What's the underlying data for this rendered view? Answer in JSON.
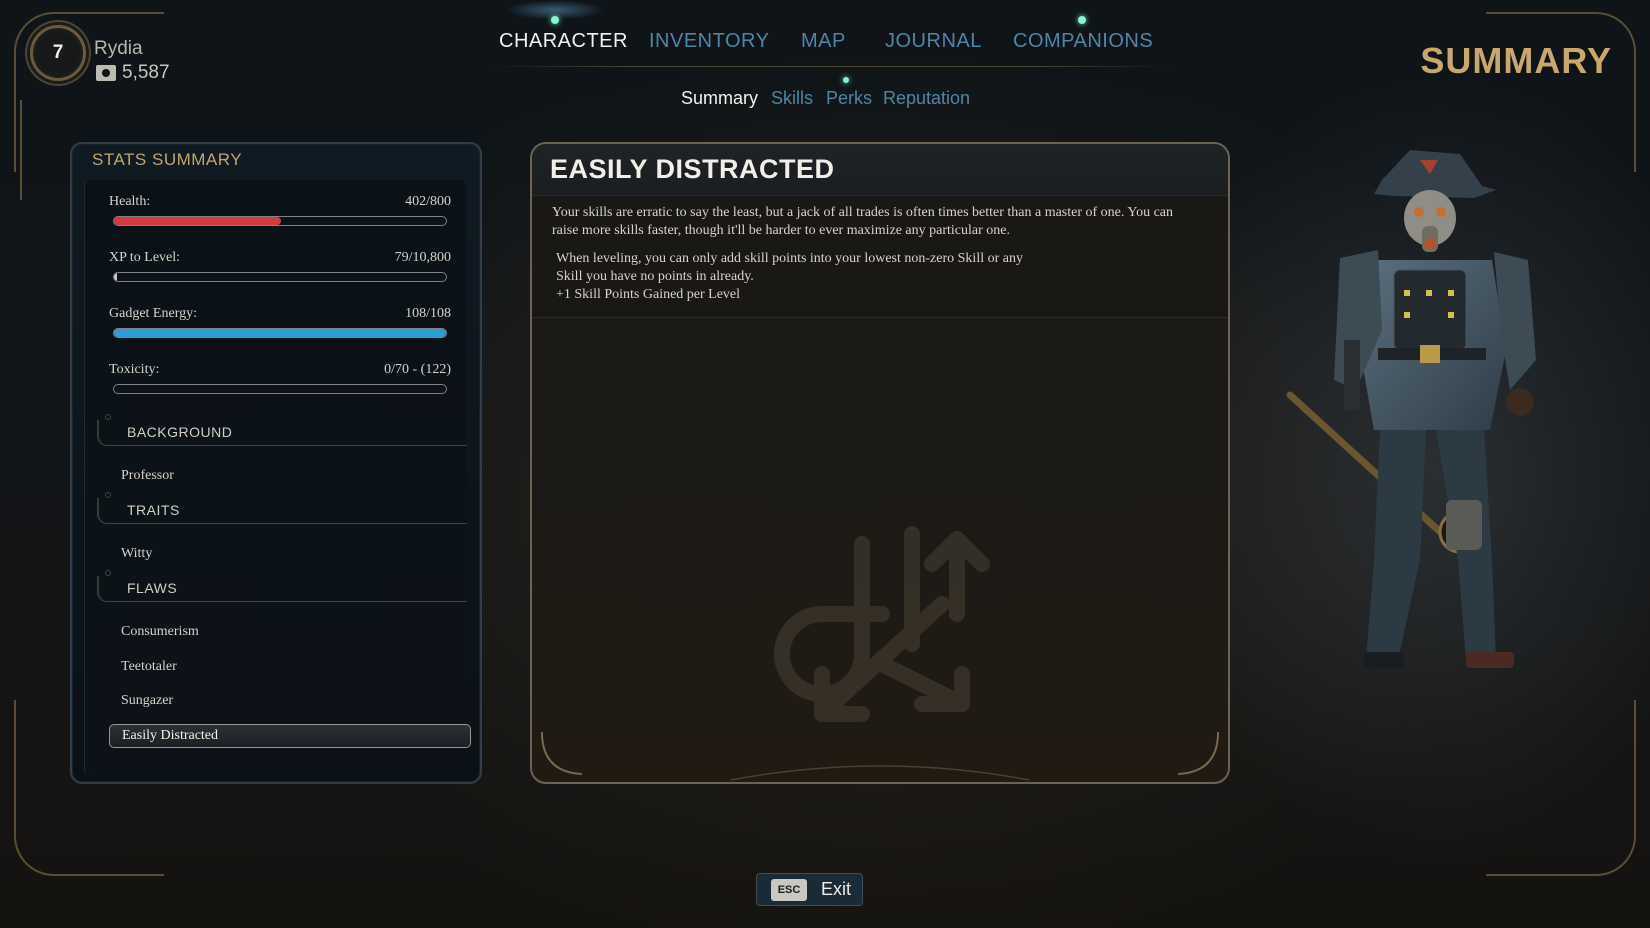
{
  "player": {
    "level": "7",
    "name": "Rydia",
    "bits": "5,587"
  },
  "nav": {
    "tabs": [
      {
        "label": "CHARACTER",
        "active": true,
        "notification": true
      },
      {
        "label": "INVENTORY",
        "active": false,
        "notification": false
      },
      {
        "label": "MAP",
        "active": false,
        "notification": false
      },
      {
        "label": "JOURNAL",
        "active": false,
        "notification": false
      },
      {
        "label": "COMPANIONS",
        "active": false,
        "notification": true
      }
    ],
    "subtabs": [
      {
        "label": "Summary",
        "active": true,
        "notification": false
      },
      {
        "label": "Skills",
        "active": false,
        "notification": false
      },
      {
        "label": "Perks",
        "active": false,
        "notification": true
      },
      {
        "label": "Reputation",
        "active": false,
        "notification": false
      }
    ]
  },
  "page_heading": "SUMMARY",
  "stats_panel": {
    "title": "STATS SUMMARY",
    "stats": [
      {
        "label": "Health:",
        "value": "402/800",
        "fill": 0.5025,
        "color": "#d23a40"
      },
      {
        "label": "XP to Level:",
        "value": "79/10,800",
        "fill": 0.0073,
        "color": "#c8c8c8"
      },
      {
        "label": "Gadget Energy:",
        "value": "108/108",
        "fill": 1.0,
        "color": "#2a9fd6"
      },
      {
        "label": "Toxicity:",
        "value": "0/70 - (122)",
        "fill": 0.0,
        "color": "#7fbf4a"
      }
    ],
    "background_header": "BACKGROUND",
    "background": "Professor",
    "traits_header": "TRAITS",
    "trait": "Witty",
    "flaws_header": "FLAWS",
    "flaws": [
      "Consumerism",
      "Teetotaler",
      "Sungazer",
      "Easily Distracted"
    ],
    "selected_flaw_index": 3
  },
  "detail": {
    "title": "EASILY DISTRACTED",
    "description": "Your skills are erratic to say the least, but a jack of all trades is often times better than a master of one. You can raise more skills faster, though it'll be harder to ever maximize any particular one.",
    "effect_line1": "When leveling, you can only add skill points into your lowest non-zero Skill or any",
    "effect_line2": "Skill you have no points in already.",
    "effect_line3": "+1 Skill Points Gained per Level"
  },
  "exit": {
    "key": "ESC",
    "label": "Exit"
  },
  "colors": {
    "accent_gold": "#c9a869",
    "tab_inactive": "#4d86a6",
    "notification": "#8af3d0"
  }
}
